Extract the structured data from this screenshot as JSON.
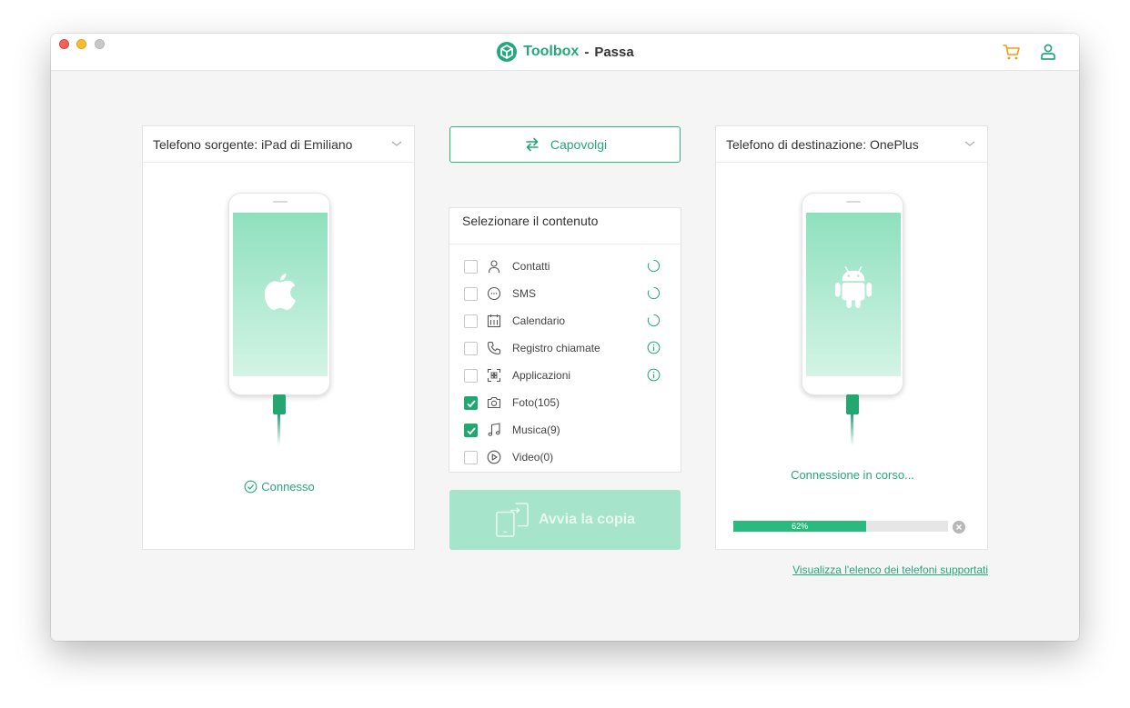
{
  "window": {
    "brand": "Toolbox",
    "separator": "-",
    "product": "Passa"
  },
  "source": {
    "header": "Telefono sorgente: iPad di Emiliano",
    "status": "Connesso"
  },
  "destination": {
    "header": "Telefono di destinazione: OnePlus",
    "status": "Connessione in corso...",
    "progress_label": "62%",
    "progress": 0.62
  },
  "flip_button": {
    "label": "Capovolgi"
  },
  "content": {
    "title": "Selezionare il contenuto",
    "items": [
      {
        "label": "Contatti",
        "checked": false,
        "icon": "contact-icon",
        "status": "loading"
      },
      {
        "label": "SMS",
        "checked": false,
        "icon": "message-icon",
        "status": "loading"
      },
      {
        "label": "Calendario",
        "checked": false,
        "icon": "calendar-icon",
        "status": "loading"
      },
      {
        "label": "Registro chiamate",
        "checked": false,
        "icon": "phone-icon",
        "status": "info"
      },
      {
        "label": "Applicazioni",
        "checked": false,
        "icon": "apps-icon",
        "status": "info"
      },
      {
        "label": "Foto(105)",
        "checked": true,
        "icon": "camera-icon",
        "status": ""
      },
      {
        "label": "Musica(9)",
        "checked": true,
        "icon": "music-icon",
        "status": ""
      },
      {
        "label": "Video(0)",
        "checked": false,
        "icon": "video-icon",
        "status": ""
      }
    ]
  },
  "start_button": {
    "label": "Avvia la copia"
  },
  "support_link": "Visualizza l'elenco dei telefoni supportati",
  "colors": {
    "accent": "#25a77c",
    "cart": "#f39c12"
  }
}
